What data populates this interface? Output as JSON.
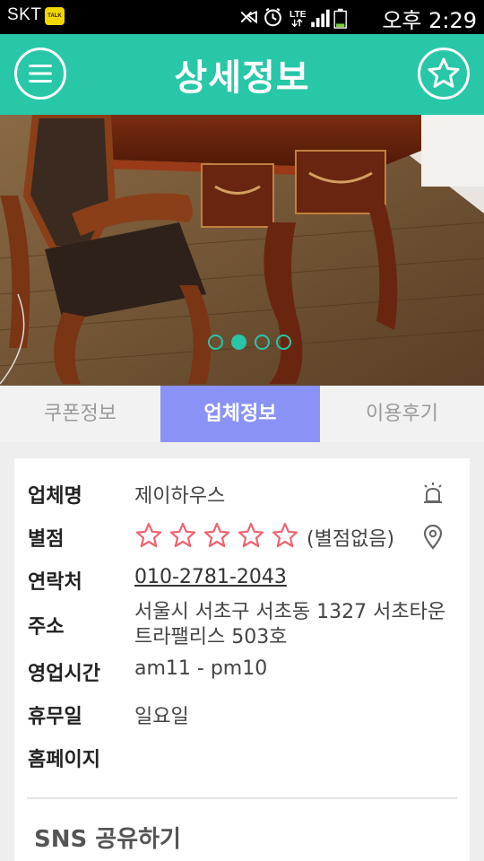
{
  "status_bar": {
    "carrier": "SKT",
    "talk_badge": "TALK",
    "time": "오후 2:29",
    "network": "LTE",
    "icons": [
      "kakaotalk-icon",
      "mute-icon",
      "alarm-icon",
      "lte-icon",
      "signal-icon",
      "battery-icon"
    ]
  },
  "header": {
    "title": "상세정보",
    "menu_icon": "menu-icon",
    "favorite_icon": "star-icon",
    "color": "#27c7a8"
  },
  "carousel": {
    "image": "antique wooden desk and chair",
    "page_count": 4,
    "active_index": 1
  },
  "tabs": [
    {
      "label": "쿠폰정보",
      "active": false
    },
    {
      "label": "업체정보",
      "active": true
    },
    {
      "label": "이용후기",
      "active": false
    }
  ],
  "tab_active_color": "#8a93f5",
  "details": {
    "name_label": "업체명",
    "name_value": "제이하우스",
    "rating_label": "별점",
    "rating_value": 0,
    "rating_max": 5,
    "rating_text": "(별점없음)",
    "contact_label": "연락처",
    "contact_value": "010-2781-2043",
    "address_label": "주소",
    "address_value": "서울시 서초구 서초동 1327 서초타운 트라팰리스 503호",
    "hours_label": "영업시간",
    "hours_value": "am11 - pm10",
    "holiday_label": "휴무일",
    "holiday_value": "일요일",
    "homepage_label": "홈페이지",
    "homepage_value": "",
    "star_color": "#f06270"
  },
  "sns_label": "SNS 공유하기"
}
